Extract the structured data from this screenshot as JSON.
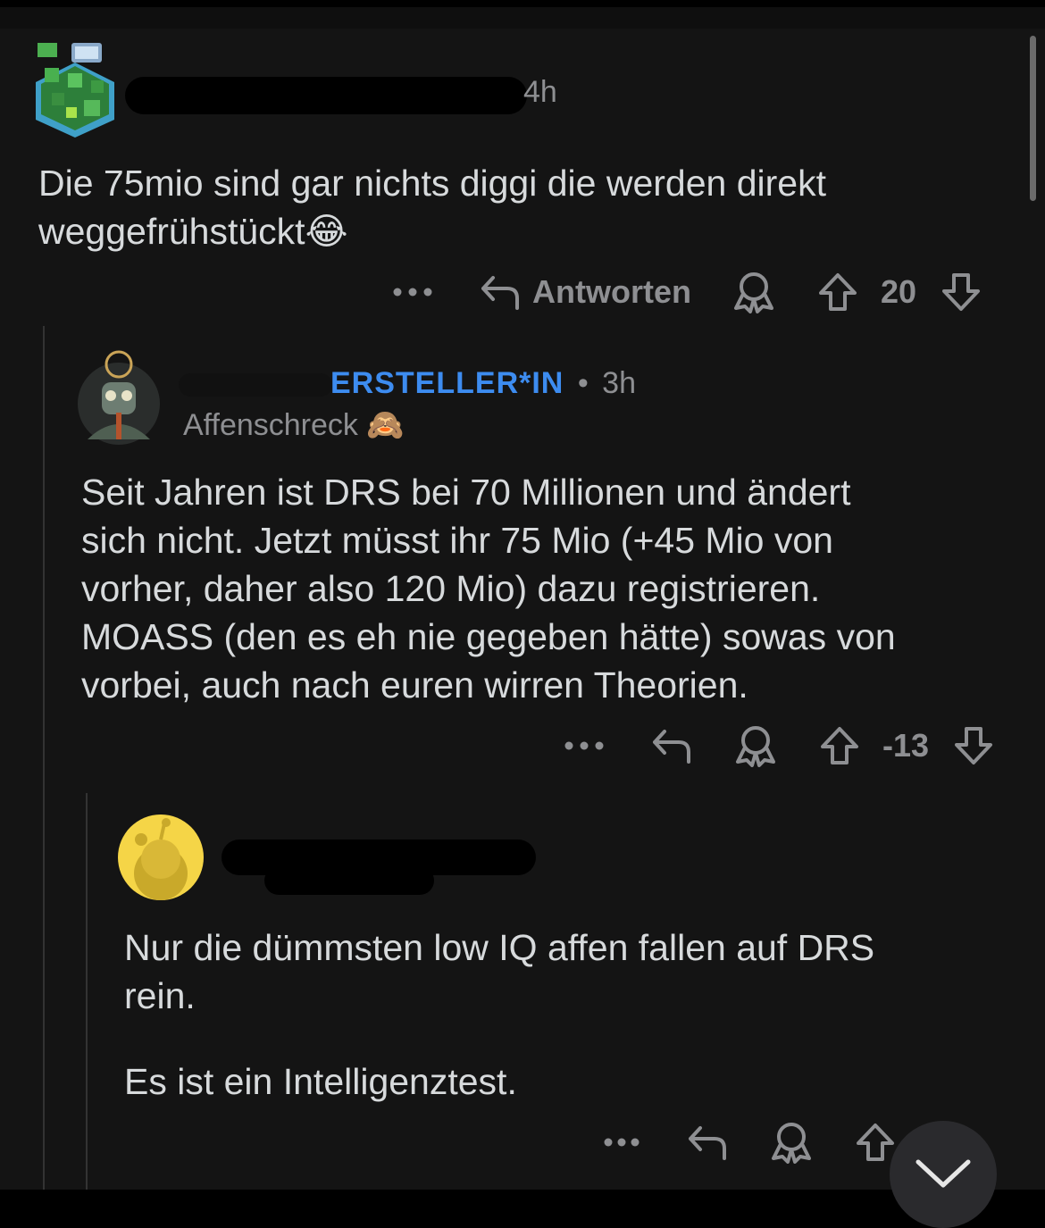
{
  "comments": [
    {
      "time": "4h",
      "text_lines": [
        "Die 75mio sind gar nichts diggi die werden direkt",
        "weggefrühstückt"
      ],
      "emoji": "😂",
      "reply_label": "Antworten",
      "score": "20"
    },
    {
      "op_badge": "ERSTELLER*IN",
      "separator": "•",
      "time": "3h",
      "flair_text": "Affenschreck",
      "flair_emoji": "🙈",
      "text_lines": [
        "Seit Jahren ist DRS bei 70 Millionen und ändert",
        "sich nicht. Jetzt müsst ihr 75 Mio (+45 Mio von",
        "vorher, daher also 120 Mio) dazu registrieren.",
        "MOASS (den es eh nie gegeben hätte) sowas von",
        "vorbei, auch nach euren wirren Theorien."
      ],
      "score": "-13"
    },
    {
      "paragraph1_lines": [
        "Nur die dümmsten low IQ affen fallen auf DRS",
        "rein."
      ],
      "paragraph2": "Es ist ein Intelligenztest."
    }
  ],
  "icons": {
    "more": "more-options-icon",
    "reply": "reply-arrow-icon",
    "award": "award-icon",
    "upvote": "upvote-arrow-icon",
    "downvote": "downvote-arrow-icon",
    "fab": "chevron-down-icon"
  },
  "colors": {
    "background": "#141414",
    "text": "#d7dadc",
    "muted": "#8e8f92",
    "op_badge": "#3d8cf0",
    "thread_line": "#333333",
    "snoo_yellow": "#f5d547"
  }
}
